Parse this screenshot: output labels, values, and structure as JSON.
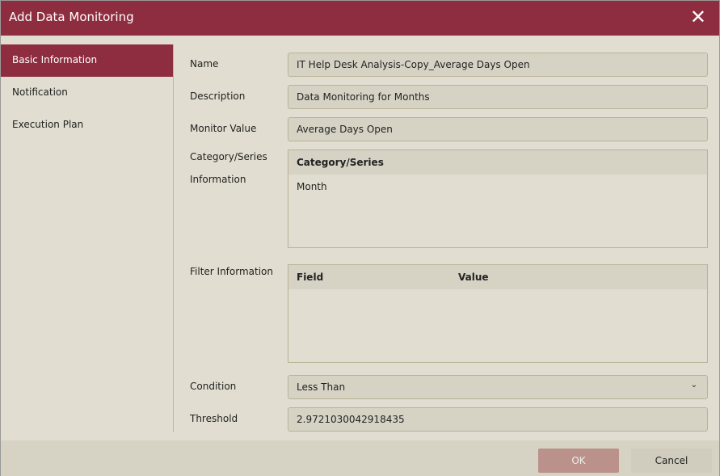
{
  "title": "Add Data Monitoring",
  "sidebar": {
    "items": [
      {
        "label": "Basic Information"
      },
      {
        "label": "Notification"
      },
      {
        "label": "Execution Plan"
      }
    ]
  },
  "form": {
    "name_label": "Name",
    "name_value": "IT Help Desk Analysis-Copy_Average Days Open",
    "description_label": "Description",
    "description_value": "Data Monitoring for Months",
    "monitor_label": "Monitor Value",
    "monitor_value": "Average Days Open",
    "category_label_1": "Category/Series",
    "category_label_2": "Information",
    "category_header": "Category/Series",
    "category_rows": [
      "Month"
    ],
    "filter_label": "Filter Information",
    "filter_headers": [
      "Field",
      "Value"
    ],
    "condition_label": "Condition",
    "condition_value": "Less Than",
    "threshold_label": "Threshold",
    "threshold_value": "2.9721030042918435"
  },
  "footer": {
    "ok": "OK",
    "cancel": "Cancel"
  },
  "colors": {
    "accent": "#8f2d40",
    "ok_disabled": "#bb918c"
  }
}
